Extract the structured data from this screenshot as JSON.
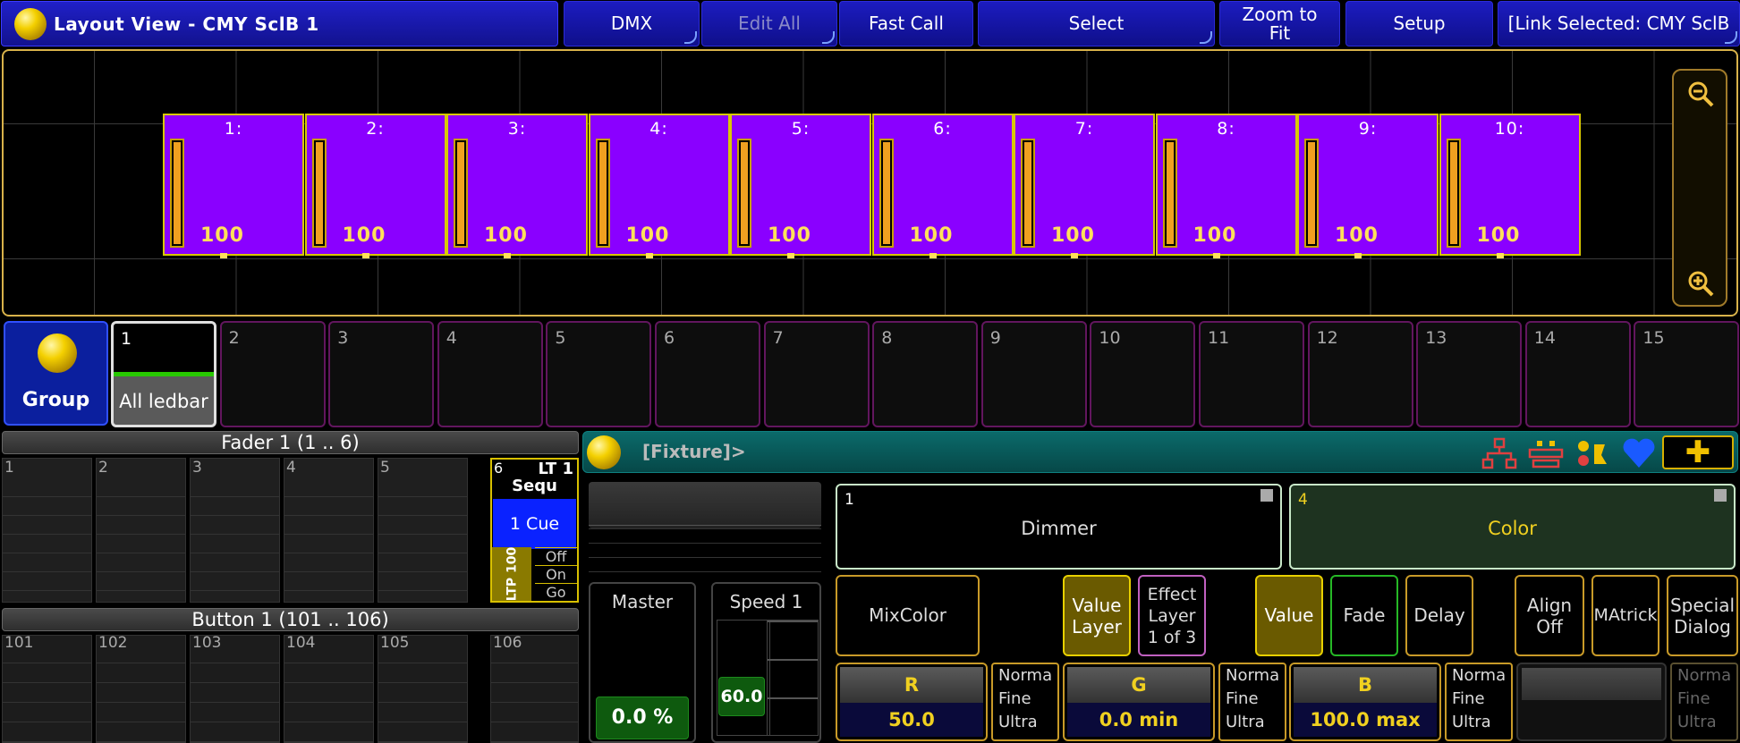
{
  "title_bar": {
    "title": "Layout View - CMY SclB 1"
  },
  "toolbar": [
    {
      "label": "DMX",
      "disabled": false,
      "corner": true
    },
    {
      "label": "Edit All",
      "disabled": true,
      "corner": true
    },
    {
      "label": "Fast Call",
      "disabled": false,
      "corner": false
    },
    {
      "label": "Select",
      "disabled": false,
      "corner": true
    },
    {
      "label": "Zoom to\nFit",
      "disabled": false,
      "corner": false
    },
    {
      "label": "Setup",
      "disabled": false,
      "corner": false
    },
    {
      "label": "[Link Selected: CMY SclB",
      "disabled": false,
      "corner": true
    }
  ],
  "layout": {
    "fixtures": [
      {
        "num": "1:",
        "value": "100"
      },
      {
        "num": "2:",
        "value": "100"
      },
      {
        "num": "3:",
        "value": "100"
      },
      {
        "num": "4:",
        "value": "100"
      },
      {
        "num": "5:",
        "value": "100"
      },
      {
        "num": "6:",
        "value": "100"
      },
      {
        "num": "7:",
        "value": "100"
      },
      {
        "num": "8:",
        "value": "100"
      },
      {
        "num": "9:",
        "value": "100"
      },
      {
        "num": "10:",
        "value": "100"
      }
    ],
    "icons": {
      "zoom_out": "zoom-out-icon",
      "zoom_in": "zoom-in-icon"
    }
  },
  "groups": {
    "header": "Group",
    "items": [
      {
        "num": "1",
        "label": "All ledbar",
        "selected": true
      },
      {
        "num": "2",
        "label": ""
      },
      {
        "num": "3",
        "label": ""
      },
      {
        "num": "4",
        "label": ""
      },
      {
        "num": "5",
        "label": ""
      },
      {
        "num": "6",
        "label": ""
      },
      {
        "num": "7",
        "label": ""
      },
      {
        "num": "8",
        "label": ""
      },
      {
        "num": "9",
        "label": ""
      },
      {
        "num": "10",
        "label": ""
      },
      {
        "num": "11",
        "label": ""
      },
      {
        "num": "12",
        "label": ""
      },
      {
        "num": "13",
        "label": ""
      },
      {
        "num": "14",
        "label": ""
      },
      {
        "num": "15",
        "label": ""
      }
    ]
  },
  "faders": {
    "header": "Fader  1 (1 .. 6)",
    "slots": [
      "1",
      "2",
      "3",
      "4",
      "5"
    ],
    "exec6": {
      "num": "6",
      "top_label": "LT 1",
      "sub_label": "Sequ",
      "cue": "1 Cue",
      "ltp": "LTP 100",
      "states": [
        "Off",
        "On",
        "Go"
      ]
    }
  },
  "buttons": {
    "header": "Button  1 (101 .. 106)",
    "slots": [
      "101",
      "102",
      "103",
      "104",
      "105",
      "106"
    ]
  },
  "master": {
    "label": "Master",
    "value": "0.0 %"
  },
  "speed": {
    "label": "Speed 1",
    "value": "60.0"
  },
  "encoder_bar": {
    "crumb": "[Fixture]>",
    "plus_label": "✚",
    "icons": [
      "network-icon",
      "stage-icon",
      "fixture-icon",
      "heart-icon"
    ],
    "colors": {
      "network": "#e04040",
      "heart": "#1a5aff"
    }
  },
  "attributes": {
    "dimmer": {
      "num": "1",
      "label": "Dimmer"
    },
    "color": {
      "num": "4",
      "label": "Color"
    }
  },
  "controls": {
    "mixcolor": "MixColor",
    "value_layer": "Value\nLayer",
    "effect_layer": "Effect\nLayer\n1 of 3",
    "value": "Value",
    "fade": "Fade",
    "delay": "Delay",
    "align": "Align\nOff",
    "matrick": "MAtrick",
    "special": "Special\nDialog"
  },
  "encoders": [
    {
      "name": "R",
      "value": "50.0",
      "mode": [
        "Norma",
        "Fine",
        "Ultra"
      ]
    },
    {
      "name": "G",
      "value": "0.0 min",
      "mode": [
        "Norma",
        "Fine",
        "Ultra"
      ]
    },
    {
      "name": "B",
      "value": "100.0 max",
      "mode": [
        "Norma",
        "Fine",
        "Ultra"
      ]
    }
  ],
  "encoder4_mode": [
    "Norma",
    "Fine",
    "Ultra"
  ]
}
